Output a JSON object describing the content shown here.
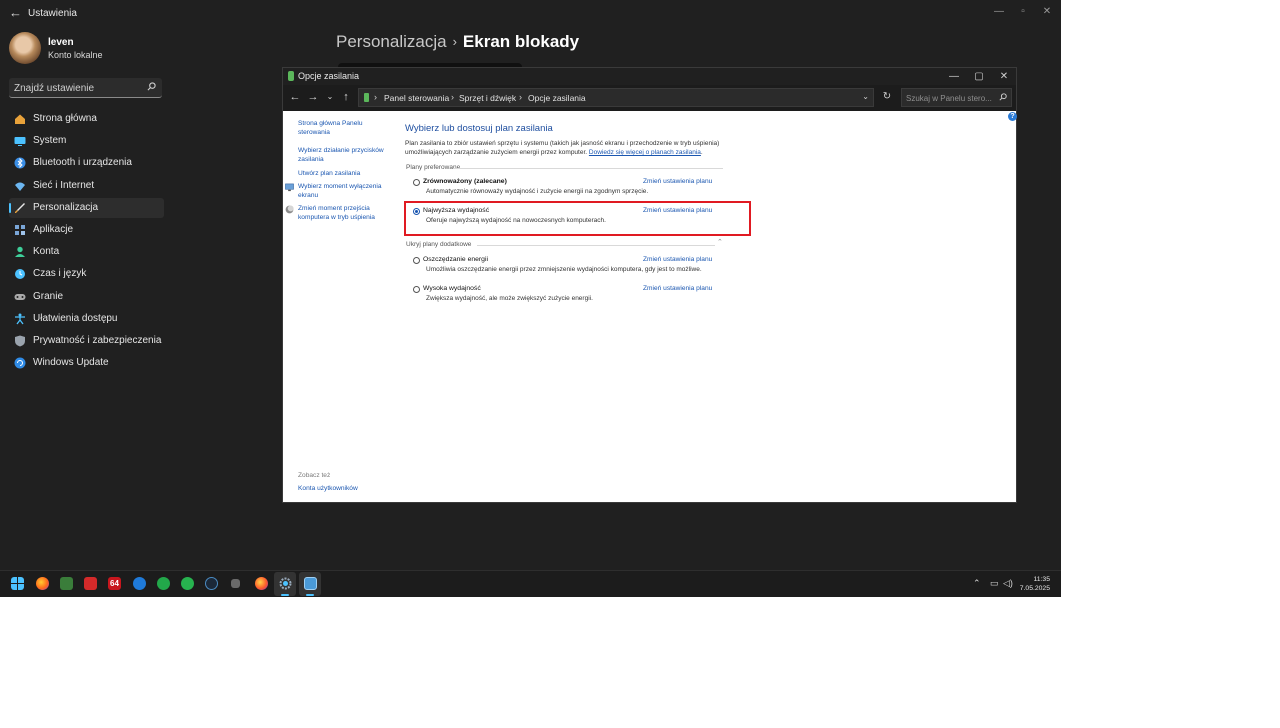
{
  "settings": {
    "app_title": "Ustawienia",
    "user": {
      "name": "leven",
      "account_type": "Konto lokalne"
    },
    "search_placeholder": "Znajdź ustawienie",
    "nav_items": [
      {
        "label": "Strona główna",
        "icon": "home-icon",
        "color": "#e8a23a"
      },
      {
        "label": "System",
        "icon": "system-icon",
        "color": "#4cc2ff"
      },
      {
        "label": "Bluetooth i urządzenia",
        "icon": "bluetooth-icon",
        "color": "#3a8ee6"
      },
      {
        "label": "Sieć i Internet",
        "icon": "network-icon",
        "color": "#6cb6f0"
      },
      {
        "label": "Personalizacja",
        "icon": "brush-icon",
        "color": "#e8a23a",
        "active": true
      },
      {
        "label": "Aplikacje",
        "icon": "apps-icon",
        "color": "#7aa6d8"
      },
      {
        "label": "Konta",
        "icon": "accounts-icon",
        "color": "#3ecf9a"
      },
      {
        "label": "Czas i język",
        "icon": "time-language-icon",
        "color": "#4cc2ff"
      },
      {
        "label": "Granie",
        "icon": "gaming-icon",
        "color": "#aaaaaa"
      },
      {
        "label": "Ułatwienia dostępu",
        "icon": "accessibility-icon",
        "color": "#4cc2ff"
      },
      {
        "label": "Prywatność i zabezpieczenia",
        "icon": "shield-icon",
        "color": "#9aa3ad"
      },
      {
        "label": "Windows Update",
        "icon": "windows-update-icon",
        "color": "#2f8be6"
      }
    ],
    "header": {
      "section": "Personalizacja",
      "page": "Ekran blokady"
    }
  },
  "control_panel": {
    "title": "Opcje zasilania",
    "breadcrumbs": [
      "Panel sterowania",
      "Sprzęt i dźwięk",
      "Opcje zasilania"
    ],
    "search_placeholder": "Szukaj w Panelu stero...",
    "sidebar_links": [
      "Strona główna Panelu sterowania",
      "Wybierz działanie przycisków zasilania",
      "Utwórz plan zasilania",
      "Wybierz moment wyłączenia ekranu",
      "Zmień moment przejścia komputera w tryb uśpienia"
    ],
    "see_also": "Zobacz też",
    "user_accounts": "Konta użytkowników",
    "main_title": "Wybierz lub dostosuj plan zasilania",
    "description": "Plan zasilania to zbiór ustawień sprzętu i systemu (takich jak jasność ekranu i przechodzenie w tryb uśpienia) umożliwiających zarządzanie zużyciem energii przez komputer.",
    "learn_more": "Dowiedz się więcej o planach zasilania",
    "preferred_heading": "Plany preferowane",
    "hide_heading": "Ukryj plany dodatkowe",
    "change_link": "Zmień ustawienia planu",
    "plans": [
      {
        "name": "Zrównoważony (zalecane)",
        "desc": "Automatycznie równoważy wydajność i zużycie energii na zgodnym sprzęcie.",
        "selected": false
      },
      {
        "name": "Najwyższa wydajność",
        "desc": "Oferuje najwyższą wydajność na nowoczesnych komputerach.",
        "selected": true
      },
      {
        "name": "Oszczędzanie energii",
        "desc": "Umożliwia oszczędzanie energii przez zmniejszenie wydajności komputera, gdy jest to możliwe.",
        "selected": false
      },
      {
        "name": "Wysoka wydajność",
        "desc": "Zwiększa wydajność, ale może zwiększyć zużycie energii.",
        "selected": false
      }
    ]
  },
  "taskbar": {
    "time": "11:35",
    "date": "7.05.2025",
    "pinned": [
      "start-icon",
      "firefox-icon",
      "game-icon",
      "flash-icon",
      "64-icon",
      "app-blue-icon",
      "app-green-icon",
      "app-green2-icon",
      "steam-icon",
      "app-small-icon",
      "firefox-dev-icon",
      "settings-icon",
      "control-panel-icon"
    ],
    "badge_64": "64"
  }
}
